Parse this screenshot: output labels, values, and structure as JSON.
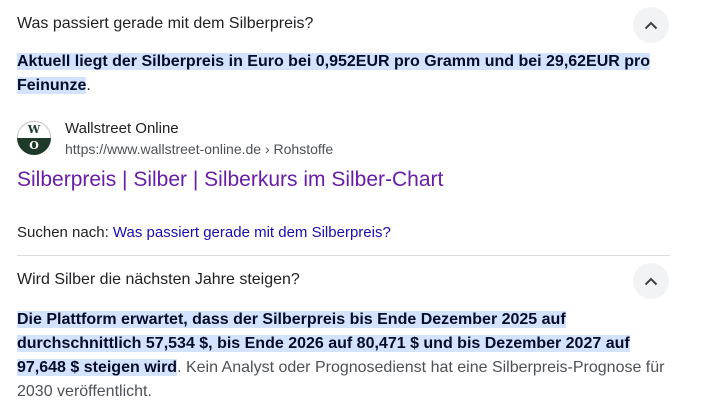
{
  "faq": [
    {
      "question": "Was passiert gerade mit dem Silberpreis?",
      "answer_highlight": "Aktuell liegt der Silberpreis in Euro bei 0,952EUR pro Gramm und bei 29,62EUR pro Feinunze",
      "answer_rest": "."
    },
    {
      "question": "Wird Silber die nächsten Jahre steigen?",
      "answer_highlight": "Die Plattform erwartet, dass der Silberpreis bis Ende Dezember 2025 auf durchschnittlich 57,534 $, bis Ende 2026 auf 80,471 $ und bis Dezember 2027 auf 97,648 $ steigen wird",
      "answer_rest": ". Kein Analyst oder Prognosedienst hat eine Silberpreis-Prognose für 2030 veröffentlicht."
    }
  ],
  "source": {
    "favicon_letters": [
      "W",
      "O"
    ],
    "site_name": "Wallstreet Online",
    "url": "https://www.wallstreet-online.de › Rohstoffe",
    "title": "Silberpreis | Silber | Silberkurs im Silber-Chart"
  },
  "search_for": {
    "label": "Suchen nach: ",
    "query": "Was passiert gerade mit dem Silberpreis?"
  },
  "icons": {
    "collapse": "chevron-up-icon"
  },
  "colors": {
    "highlight_bg": "#d3e3fd",
    "visited_link": "#681da8",
    "link": "#1a0dab",
    "chevron_bg": "#f1f3f4"
  }
}
